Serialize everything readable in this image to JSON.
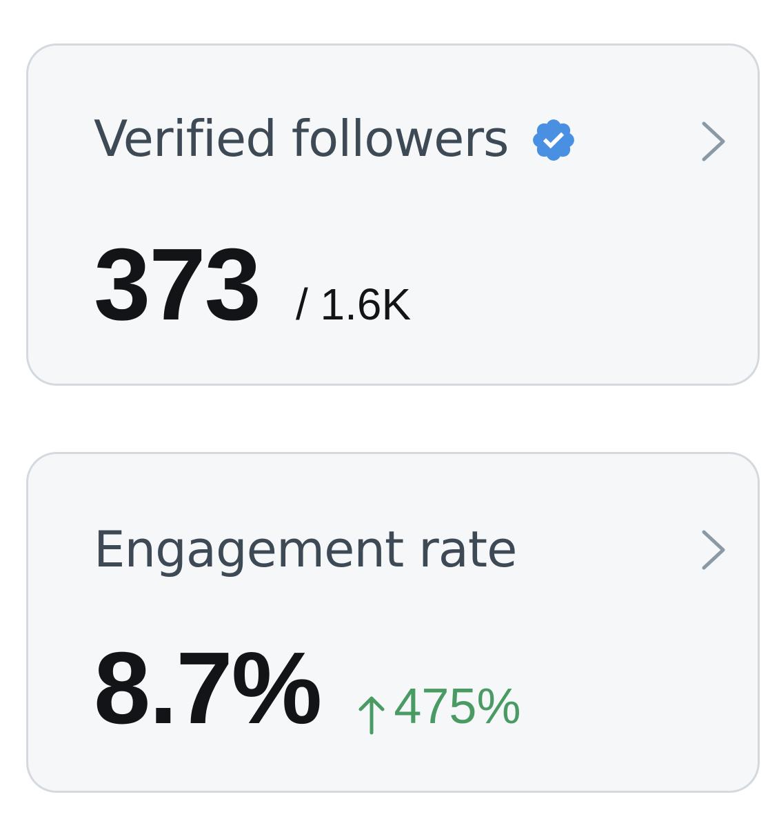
{
  "cards": [
    {
      "title": "Verified followers",
      "value": "373",
      "secondary": "/ 1.6K",
      "icons": [
        "verified-badge-icon",
        "chevron-right-icon"
      ]
    },
    {
      "title": "Engagement rate",
      "value": "8.7%",
      "change": {
        "direction": "up",
        "value": "475%"
      },
      "icons": [
        "arrow-up-icon",
        "chevron-right-icon"
      ]
    }
  ],
  "colors": {
    "card_background": "#f5f7f8",
    "card_border": "#d3d9de",
    "title_text": "#3d4954",
    "value_text": "#121417",
    "verified_blue": "#4a90e2",
    "positive_green": "#4a9a63",
    "chevron_gray": "#8b98a5"
  }
}
